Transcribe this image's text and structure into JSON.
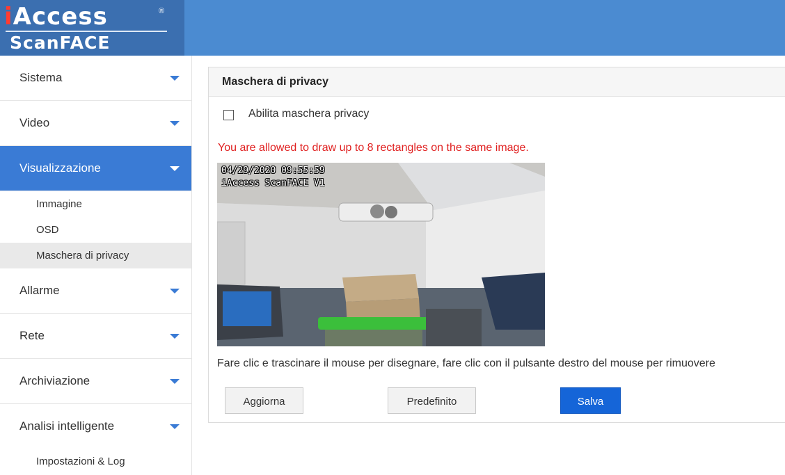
{
  "brand": {
    "logo_top": "Access",
    "logo_top_prefix": "i",
    "logo_sub": "ScanFACE",
    "registered": "®"
  },
  "sidebar": {
    "items": [
      {
        "label": "Sistema",
        "active": false
      },
      {
        "label": "Video",
        "active": false
      },
      {
        "label": "Visualizzazione",
        "active": true
      },
      {
        "label": "Allarme",
        "active": false
      },
      {
        "label": "Rete",
        "active": false
      },
      {
        "label": "Archiviazione",
        "active": false
      },
      {
        "label": "Analisi intelligente",
        "active": false
      }
    ],
    "visualizzazione_sub": [
      {
        "label": "Immagine"
      },
      {
        "label": "OSD"
      },
      {
        "label": "Maschera di privacy",
        "selected": true
      }
    ],
    "analisi_sub": [
      {
        "label": "Impostazioni & Log"
      }
    ]
  },
  "panel": {
    "title": "Maschera di privacy",
    "checkbox_label": "Abilita maschera privacy",
    "checkbox_checked": false,
    "warning": "You are allowed to draw up to 8 rectangles on the same image.",
    "video_osd_timestamp": "04/29/2020 09:55:59",
    "video_osd_name": "iAccess ScanFACE V1",
    "instructions": "Fare clic e trascinare il mouse per disegnare, fare clic con il pulsante destro del mouse per rimuovere",
    "buttons": {
      "refresh": "Aggiorna",
      "default": "Predefinito",
      "save": "Salva"
    }
  },
  "colors": {
    "header": "#4b8bd1",
    "active_menu": "#3a7bd5",
    "warning": "#e02020",
    "save_button": "#1565d8"
  },
  "icons": {
    "menu_expand": "chevron-down-icon",
    "checkbox": "checkbox-icon"
  }
}
